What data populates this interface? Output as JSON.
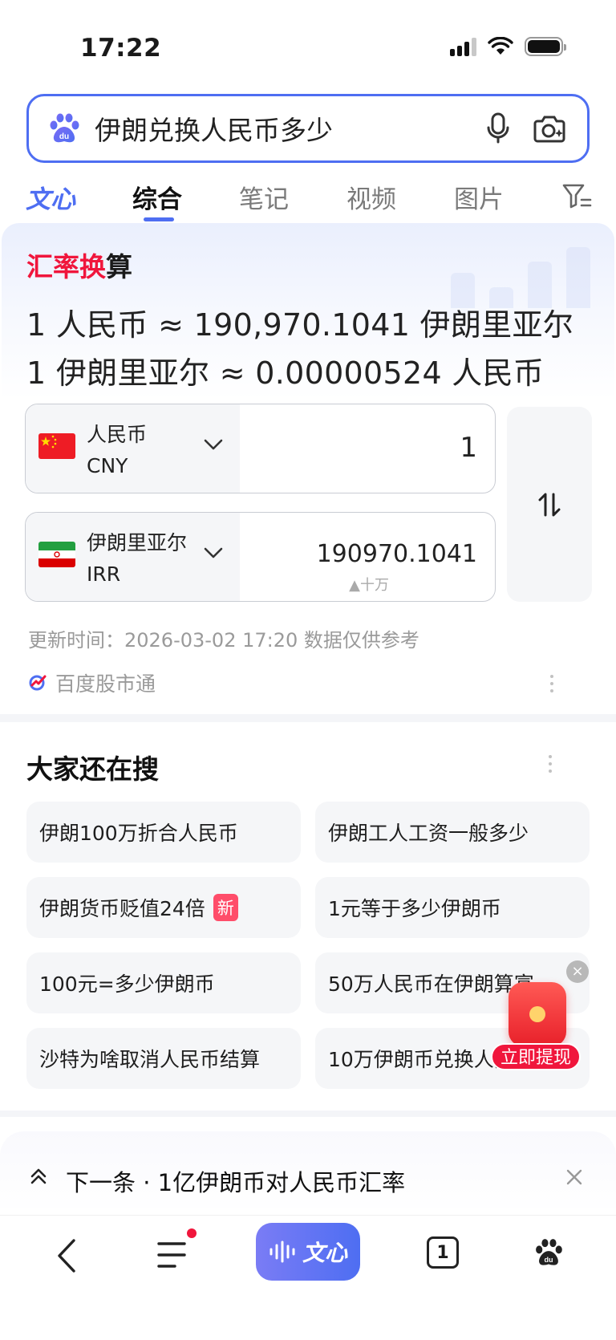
{
  "status_bar": {
    "time": "17:22"
  },
  "search": {
    "query": "伊朗兑换人民币多少"
  },
  "tabs": [
    {
      "label": "文心"
    },
    {
      "label": "综合"
    },
    {
      "label": "笔记"
    },
    {
      "label": "视频"
    },
    {
      "label": "图片"
    }
  ],
  "exchange": {
    "title_part1": "汇率换",
    "title_part2": "算",
    "rate_line_1": "1 人民币 ≈ 190,970.1041 伊朗里亚尔",
    "rate_line_2": "1 伊朗里亚尔 ≈ 0.00000524 人民币",
    "from": {
      "name": "人民币",
      "code": "CNY",
      "amount": "1"
    },
    "to": {
      "name": "伊朗里亚尔",
      "code": "IRR",
      "amount": "190970.1041",
      "unit_hint": "▲十万"
    },
    "update_time": "更新时间：2026-03-02 17:20 数据仅供参考",
    "source": "百度股市通"
  },
  "related": {
    "title": "大家还在搜",
    "items": [
      {
        "label": "伊朗100万折合人民币"
      },
      {
        "label": "伊朗工人工资一般多少"
      },
      {
        "label": "伊朗货币贬值24倍",
        "badge": "新"
      },
      {
        "label": "1元等于多少伊朗币"
      },
      {
        "label": "100元=多少伊朗币"
      },
      {
        "label": "50万人民币在伊朗算富..."
      },
      {
        "label": "沙特为啥取消人民币结算"
      },
      {
        "label": "10万伊朗币兑换人民币"
      }
    ]
  },
  "float_ad": {
    "label": "立即提现",
    "close": "×"
  },
  "next_bar": {
    "text": "下一条 · 1亿伊朗币对人民币汇率"
  },
  "bottom_nav": {
    "wenxin_label": "文心",
    "tab_count": "1"
  }
}
